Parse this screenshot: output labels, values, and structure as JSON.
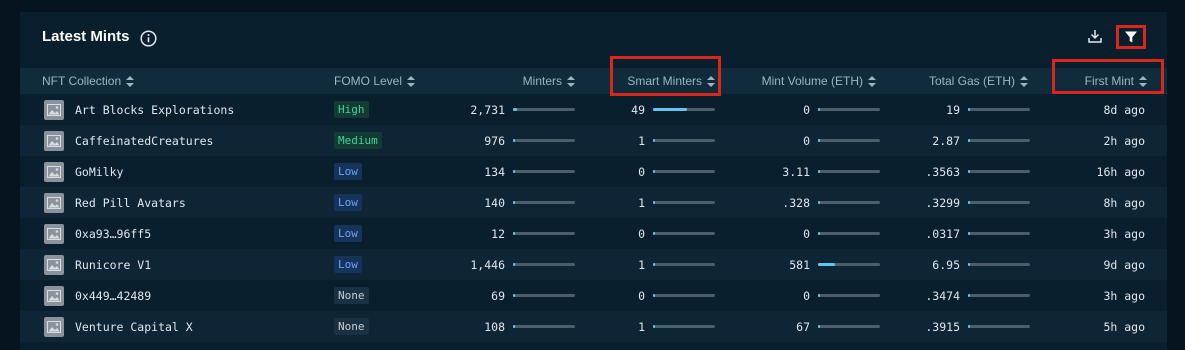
{
  "header": {
    "title": "Latest Mints"
  },
  "columns": {
    "collection": "NFT Collection",
    "fomo": "FOMO Level",
    "minters": "Minters",
    "smart_minters": "Smart Minters",
    "mint_volume": "Mint Volume (ETH)",
    "total_gas": "Total Gas (ETH)",
    "first_mint": "First Mint"
  },
  "rows": [
    {
      "name": "Art Blocks Explorations",
      "fomo": "High",
      "fomo_kind": "high",
      "minters": "2,731",
      "minters_frac": 0.07,
      "smart": "49",
      "smart_frac": 0.55,
      "volume": "0",
      "volume_frac": 0,
      "gas": "19",
      "gas_frac": 0.04,
      "first": "8d ago"
    },
    {
      "name": "CaffeinatedCreatures",
      "fomo": "Medium",
      "fomo_kind": "medium",
      "minters": "976",
      "minters_frac": 0.0,
      "smart": "1",
      "smart_frac": 0.0,
      "volume": "0",
      "volume_frac": 0,
      "gas": "2.87",
      "gas_frac": 0.0,
      "first": "2h ago"
    },
    {
      "name": "GoMilky",
      "fomo": "Low",
      "fomo_kind": "low",
      "minters": "134",
      "minters_frac": 0.0,
      "smart": "0",
      "smart_frac": 0.0,
      "volume": "3.11",
      "volume_frac": 0.0,
      "gas": ".3563",
      "gas_frac": 0.0,
      "first": "16h ago"
    },
    {
      "name": "Red Pill Avatars",
      "fomo": "Low",
      "fomo_kind": "low",
      "minters": "140",
      "minters_frac": 0.0,
      "smart": "1",
      "smart_frac": 0.0,
      "volume": ".328",
      "volume_frac": 0.0,
      "gas": ".3299",
      "gas_frac": 0.0,
      "first": "8h ago"
    },
    {
      "name": "0xa93…96ff5",
      "fomo": "Low",
      "fomo_kind": "low",
      "minters": "12",
      "minters_frac": 0.0,
      "smart": "0",
      "smart_frac": 0.0,
      "volume": "0",
      "volume_frac": 0.0,
      "gas": ".0317",
      "gas_frac": 0.0,
      "first": "3h ago"
    },
    {
      "name": "Runicore V1",
      "fomo": "Low",
      "fomo_kind": "low",
      "minters": "1,446",
      "minters_frac": 0.03,
      "smart": "1",
      "smart_frac": 0.0,
      "volume": "581",
      "volume_frac": 0.28,
      "gas": "6.95",
      "gas_frac": 0.0,
      "first": "9d ago"
    },
    {
      "name": "0x449…42489",
      "fomo": "None",
      "fomo_kind": "none",
      "minters": "69",
      "minters_frac": 0.0,
      "smart": "0",
      "smart_frac": 0.0,
      "volume": "0",
      "volume_frac": 0.0,
      "gas": ".3474",
      "gas_frac": 0.0,
      "first": "3h ago"
    },
    {
      "name": "Venture Capital X",
      "fomo": "None",
      "fomo_kind": "none",
      "minters": "108",
      "minters_frac": 0.0,
      "smart": "1",
      "smart_frac": 0.0,
      "volume": "67",
      "volume_frac": 0.0,
      "gas": ".3915",
      "gas_frac": 0.0,
      "first": "5h ago"
    }
  ],
  "icons": {
    "info": "info-icon",
    "download": "download-icon",
    "filter": "filter-icon",
    "sort": "sort-icon",
    "thumbnail": "image-placeholder-icon"
  },
  "colors": {
    "background": "#0a1f2e",
    "header_row": "#0f2b3c",
    "highlight": "#d8281c",
    "bar_fill": "#67c4ee"
  }
}
